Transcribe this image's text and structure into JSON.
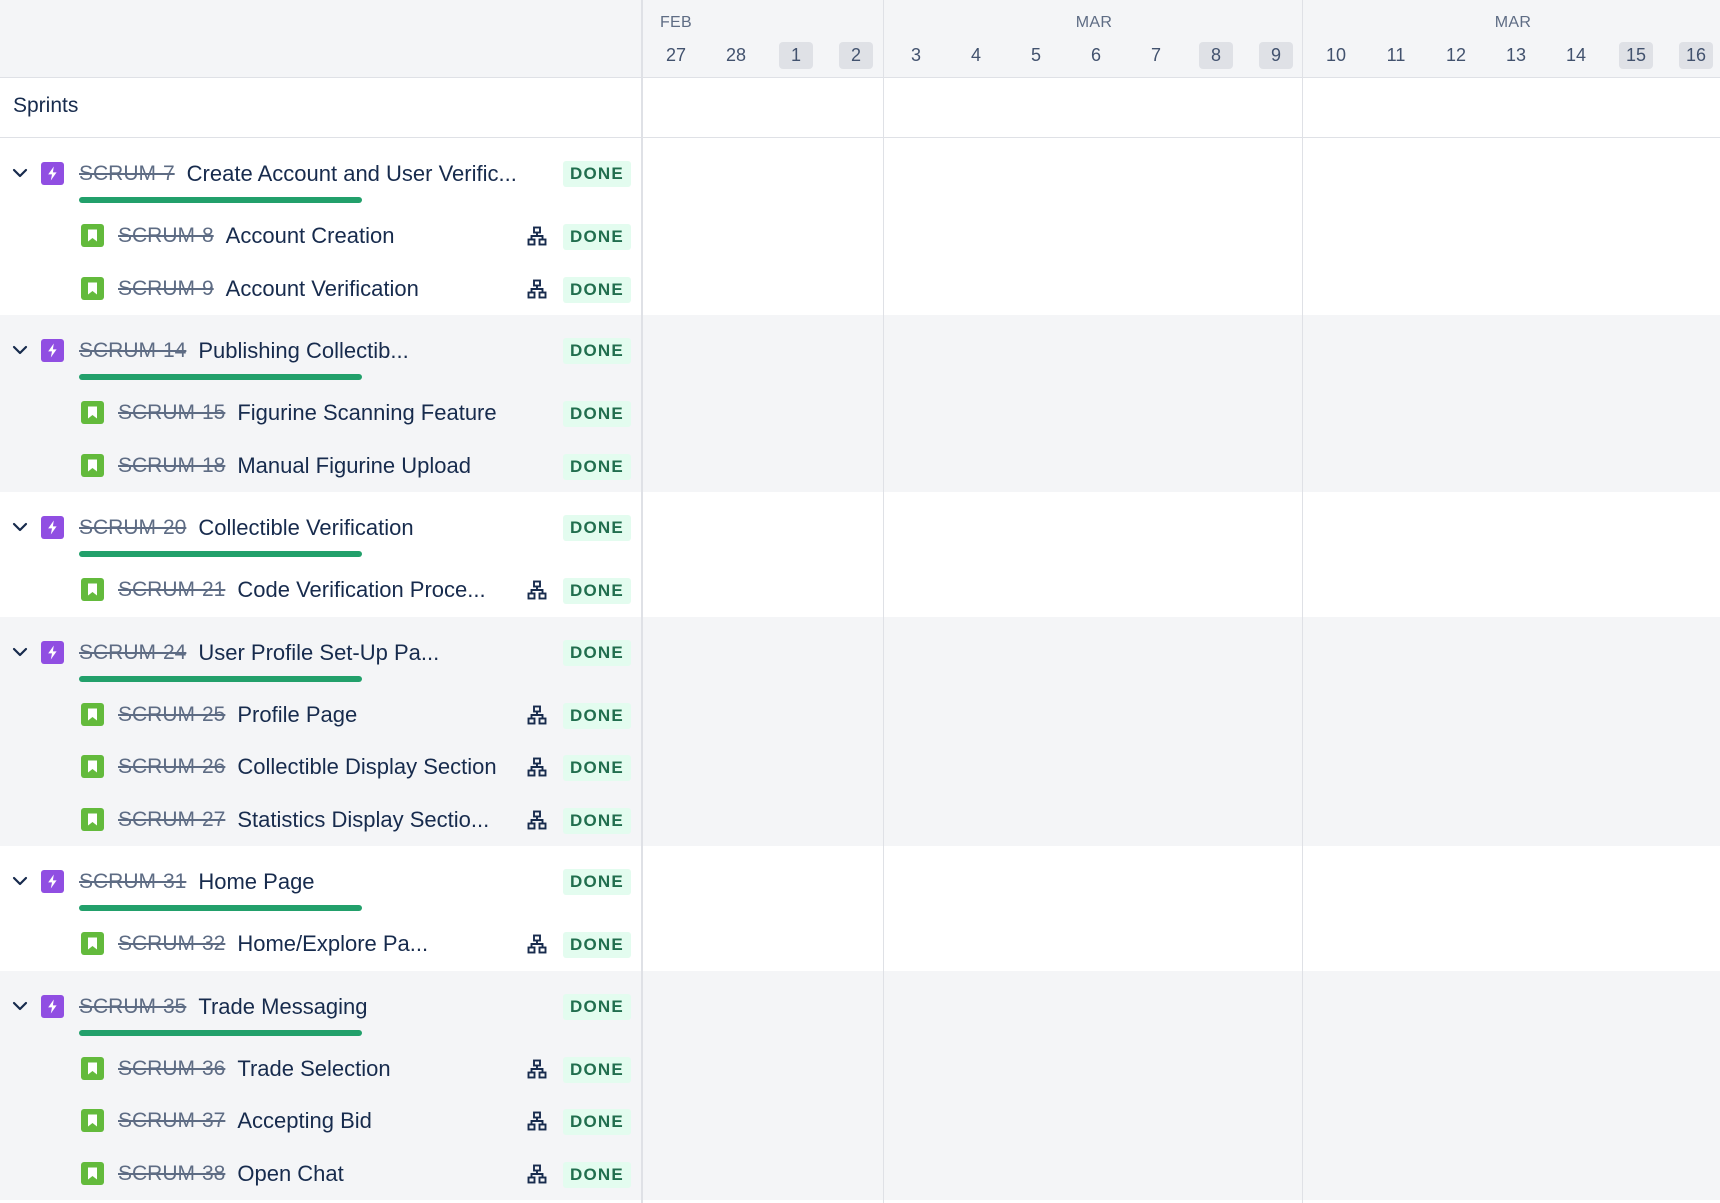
{
  "timeline": {
    "months": [
      "FEB",
      "MAR",
      "MAR"
    ],
    "days": [
      "27",
      "28",
      "1",
      "2",
      "3",
      "4",
      "5",
      "6",
      "7",
      "8",
      "9",
      "10",
      "11",
      "12",
      "13",
      "14",
      "15",
      "16"
    ],
    "weekend_days": [
      "1",
      "2",
      "8",
      "9",
      "15",
      "16"
    ]
  },
  "sprints_label": "Sprints",
  "status_label": "DONE",
  "colors": {
    "epic": "#904ee2",
    "story": "#63ba3c",
    "progress": "#22a06b",
    "done_bg": "#e3fcef",
    "done_text": "#216e4e",
    "row_shade": "#f4f5f7"
  },
  "icons": {
    "expand": "chevron-down-icon",
    "epic": "lightning-icon",
    "story": "bookmark-icon",
    "child_issues": "hierarchy-icon"
  },
  "epics": [
    {
      "key": "SCRUM-7",
      "title": "Create Account and User Verific...",
      "status": "DONE",
      "progress_complete": 1.0,
      "children": [
        {
          "key": "SCRUM-8",
          "title": "Account Creation",
          "status": "DONE",
          "has_child_issues": true
        },
        {
          "key": "SCRUM-9",
          "title": "Account Verification",
          "status": "DONE",
          "has_child_issues": true
        }
      ]
    },
    {
      "key": "SCRUM-14",
      "title": "Publishing Collectib...",
      "status": "DONE",
      "progress_complete": 1.0,
      "children": [
        {
          "key": "SCRUM-15",
          "title": "Figurine Scanning Feature",
          "status": "DONE",
          "has_child_issues": false
        },
        {
          "key": "SCRUM-18",
          "title": "Manual Figurine Upload",
          "status": "DONE",
          "has_child_issues": false
        }
      ]
    },
    {
      "key": "SCRUM-20",
      "title": "Collectible Verification",
      "status": "DONE",
      "progress_complete": 1.0,
      "children": [
        {
          "key": "SCRUM-21",
          "title": "Code Verification Proce...",
          "status": "DONE",
          "has_child_issues": true
        }
      ]
    },
    {
      "key": "SCRUM-24",
      "title": "User Profile Set-Up Pa...",
      "status": "DONE",
      "progress_complete": 1.0,
      "children": [
        {
          "key": "SCRUM-25",
          "title": "Profile Page",
          "status": "DONE",
          "has_child_issues": true
        },
        {
          "key": "SCRUM-26",
          "title": "Collectible Display Section",
          "status": "DONE",
          "has_child_issues": true
        },
        {
          "key": "SCRUM-27",
          "title": "Statistics Display Sectio...",
          "status": "DONE",
          "has_child_issues": true
        }
      ]
    },
    {
      "key": "SCRUM-31",
      "title": "Home Page",
      "status": "DONE",
      "progress_complete": 1.0,
      "children": [
        {
          "key": "SCRUM-32",
          "title": "Home/Explore Pa...",
          "status": "DONE",
          "has_child_issues": true
        }
      ]
    },
    {
      "key": "SCRUM-35",
      "title": "Trade Messaging",
      "status": "DONE",
      "progress_complete": 1.0,
      "children": [
        {
          "key": "SCRUM-36",
          "title": "Trade Selection",
          "status": "DONE",
          "has_child_issues": true
        },
        {
          "key": "SCRUM-37",
          "title": "Accepting Bid",
          "status": "DONE",
          "has_child_issues": true
        },
        {
          "key": "SCRUM-38",
          "title": "Open Chat",
          "status": "DONE",
          "has_child_issues": true
        }
      ]
    }
  ]
}
